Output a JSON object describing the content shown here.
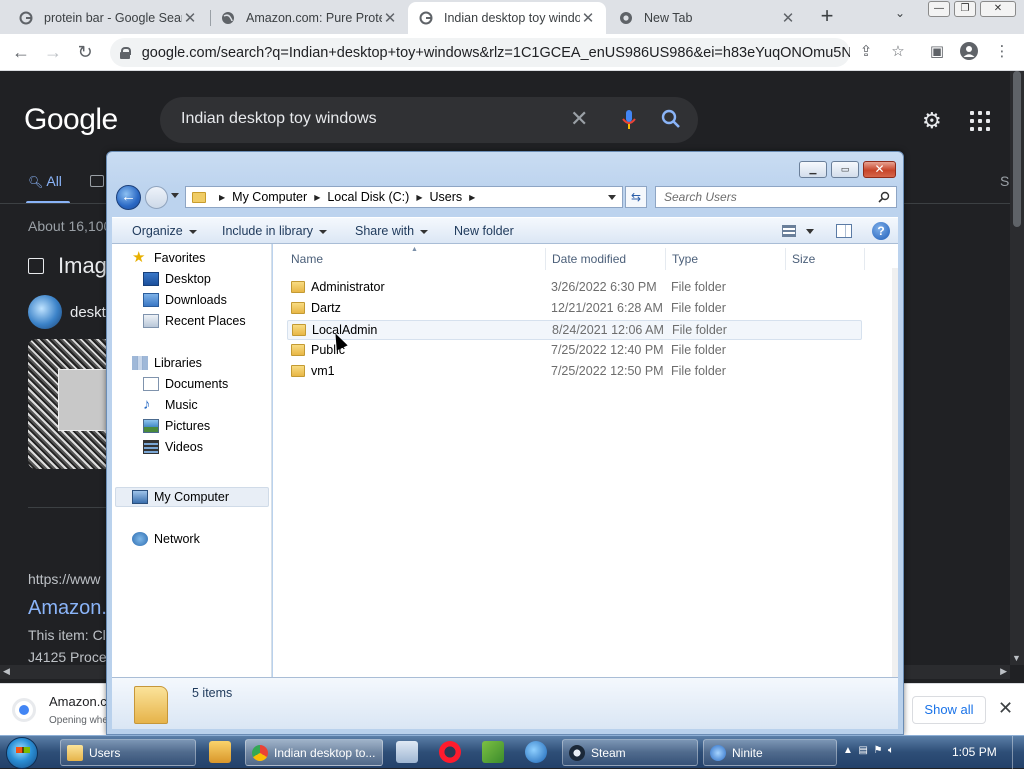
{
  "browser": {
    "tabs": [
      {
        "title": "protein bar - Google Sear",
        "favicon": "google-g"
      },
      {
        "title": "Amazon.com: Pure Protei",
        "favicon": "globe"
      },
      {
        "title": "Indian desktop toy windo",
        "favicon": "google-g",
        "active": true
      },
      {
        "title": "New Tab",
        "favicon": "chrome"
      }
    ],
    "url": "google.com/search?q=Indian+desktop+toy+windows&rlz=1C1GCEA_enUS986US986&ei=h83eYuqONOmu5No..."
  },
  "google": {
    "logo": "Google",
    "query": "Indian desktop toy windows",
    "tab_all": "All",
    "tab_partial": "S",
    "about": "About 16,100",
    "images_heading": "Imag",
    "chip_label": "deskt",
    "cite": "https://www",
    "link": "Amazon.",
    "snippet1": "This item: Cl",
    "snippet2": "J4125 Proce"
  },
  "download_bar": {
    "name": "Amazon.c",
    "status": "Opening whe",
    "show_all": "Show all"
  },
  "explorer": {
    "breadcrumb": [
      "My Computer",
      "Local Disk (C:)",
      "Users"
    ],
    "search_placeholder": "Search Users",
    "commands": {
      "organize": "Organize",
      "include": "Include in library",
      "share": "Share with",
      "new_folder": "New folder"
    },
    "nav": {
      "favorites": "Favorites",
      "desktop": "Desktop",
      "downloads": "Downloads",
      "recent": "Recent Places",
      "libraries": "Libraries",
      "documents": "Documents",
      "music": "Music",
      "pictures": "Pictures",
      "videos": "Videos",
      "computer": "My Computer",
      "network": "Network"
    },
    "columns": {
      "name": "Name",
      "date": "Date modified",
      "type": "Type",
      "size": "Size"
    },
    "files": [
      {
        "name": "Administrator",
        "date": "3/26/2022 6:30 PM",
        "type": "File folder"
      },
      {
        "name": "Dartz",
        "date": "12/21/2021 6:28 AM",
        "type": "File folder"
      },
      {
        "name": "LocalAdmin",
        "date": "8/24/2021 12:06 AM",
        "type": "File folder"
      },
      {
        "name": "Public",
        "date": "7/25/2022 12:40 PM",
        "type": "File folder"
      },
      {
        "name": "vm1",
        "date": "7/25/2022 12:50 PM",
        "type": "File folder"
      }
    ],
    "item_count": "5 items"
  },
  "taskbar": {
    "users": "Users",
    "chrome": "Indian desktop to...",
    "steam": "Steam",
    "ninite": "Ninite",
    "clock": "1:05 PM"
  }
}
